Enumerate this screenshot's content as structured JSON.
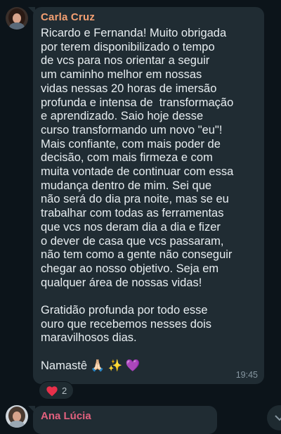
{
  "messages": [
    {
      "sender": "Carla Cruz",
      "text": "Ricardo e Fernanda! Muito obrigada\npor terem disponibilizado o tempo\nde vcs para nos orientar a seguir\num caminho melhor em nossas\nvidas nessas 20 horas de imersão\nprofunda e intensa de  transformação\ne aprendizado. Saio hoje desse\ncurso transformando um novo \"eu\"!\nMais confiante, com mais poder de\ndecisão, com mais firmeza e com\nmuita vontade de continuar com essa\nmudança dentro de mim. Sei que\nnão será do dia pra noite, mas se eu\ntrabalhar com todas as ferramentas\nque vcs nos deram dia a dia e fizer\no dever de casa que vcs passaram,\nnão tem como a gente não conseguir\nchegar ao nosso objetivo. Seja em\nqualquer área de nossas vidas!\n\nGratidão profunda por todo esse\nouro que recebemos nesses dois\nmaravilhosos dias.\n\nNamastê 🙏🏻 ✨ 💜",
      "time": "19:45",
      "reaction": {
        "icon": "heart-icon",
        "count": "2"
      }
    },
    {
      "sender": "Ana Lúcia"
    }
  ],
  "colors": {
    "background": "#0c141a",
    "bubble": "#202c33",
    "sender_1": "#f39f72",
    "sender_2": "#e2617e",
    "text": "#e7edf0",
    "time": "#8696a0"
  }
}
